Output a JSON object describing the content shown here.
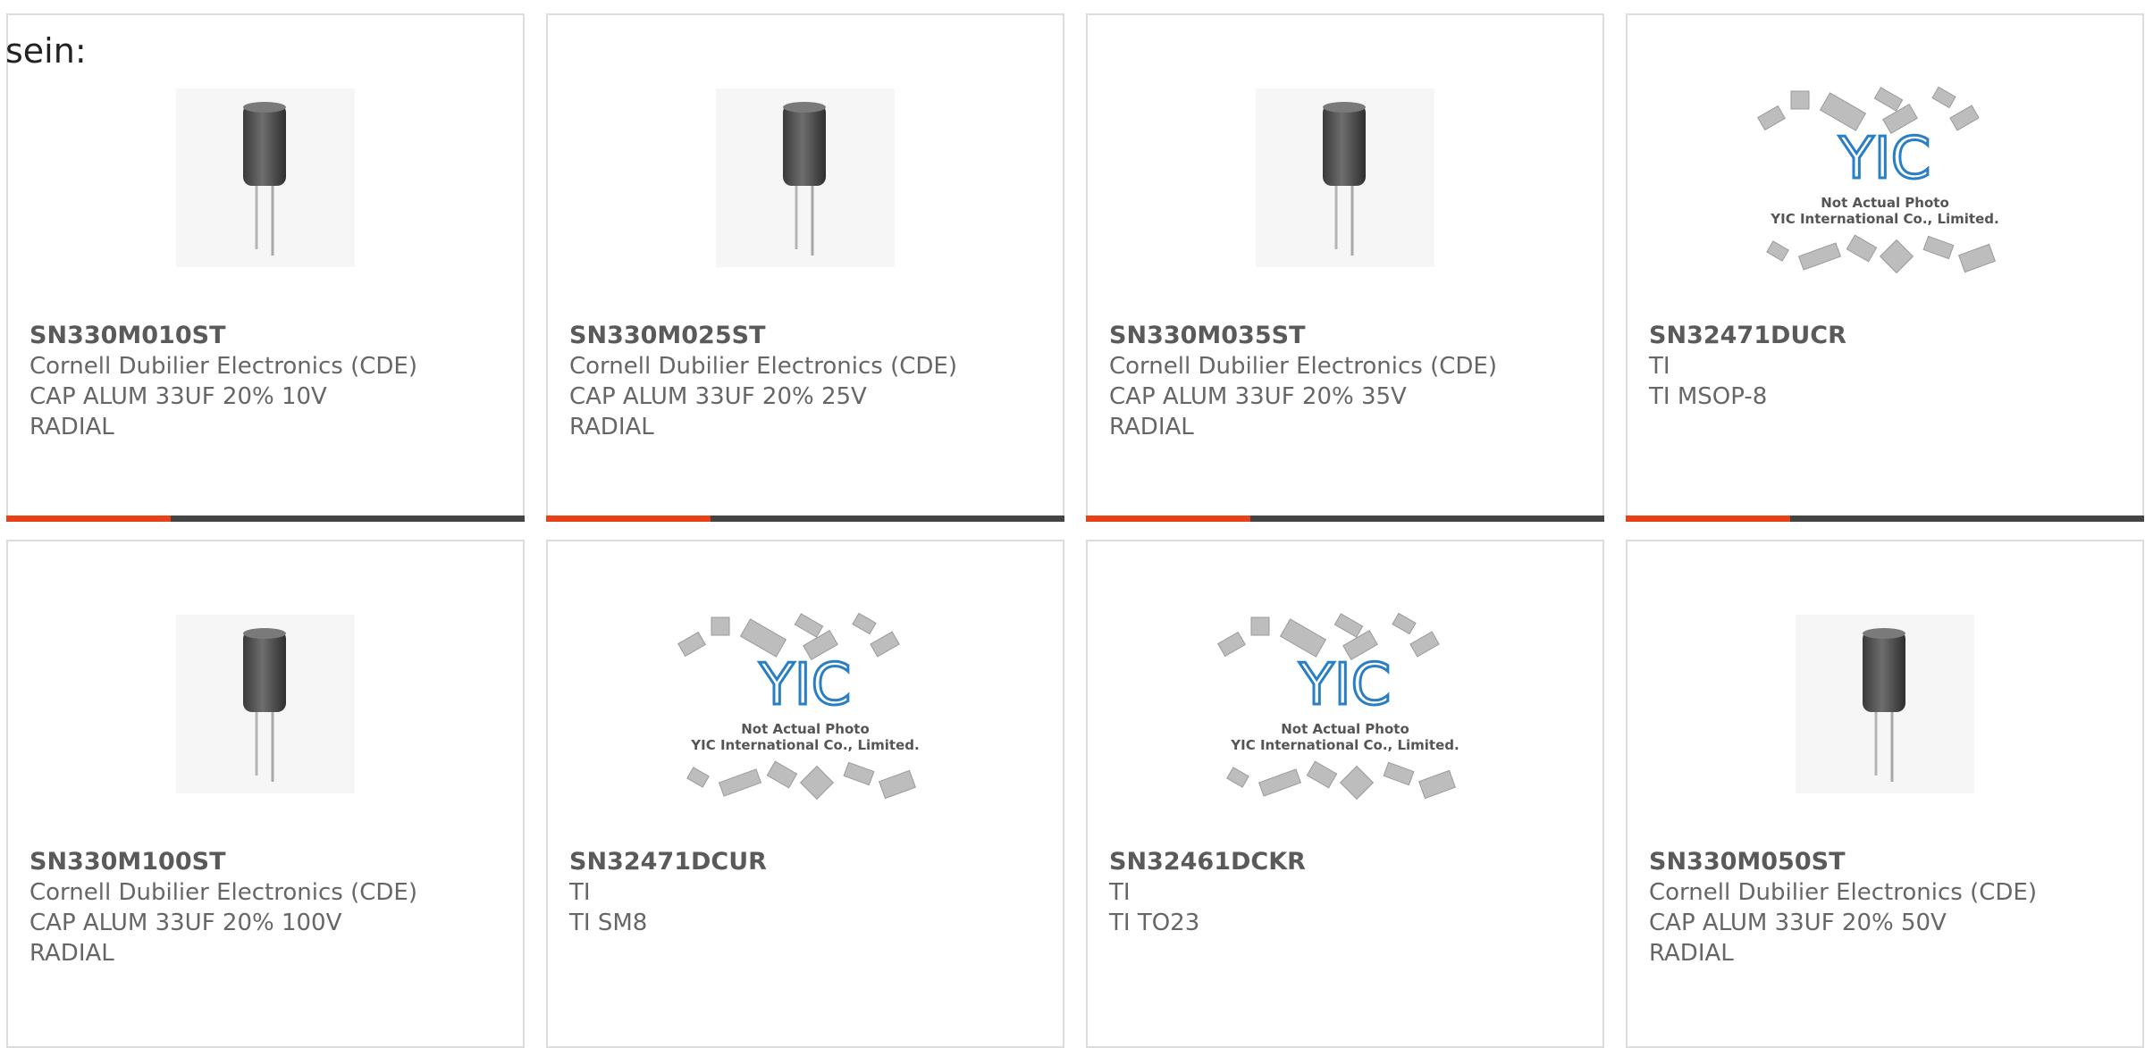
{
  "intro_text": "sein:",
  "colors": {
    "accent": "#e8411a",
    "bar": "#444444",
    "border": "#dcdcdc",
    "text": "#666666"
  },
  "placeholder_image": {
    "line1": "Not Actual Photo",
    "line2": "YIC International Co., Limited.",
    "logo": "YIC"
  },
  "products": [
    {
      "part": "SN330M010ST",
      "manufacturer": "Cornell Dubilier Electronics (CDE)",
      "desc": "CAP ALUM 33UF 20% 10V",
      "desc2": "RADIAL",
      "image": "capacitor"
    },
    {
      "part": "SN330M025ST",
      "manufacturer": "Cornell Dubilier Electronics (CDE)",
      "desc": "CAP ALUM 33UF 20% 25V",
      "desc2": "RADIAL",
      "image": "capacitor"
    },
    {
      "part": "SN330M035ST",
      "manufacturer": "Cornell Dubilier Electronics (CDE)",
      "desc": "CAP ALUM 33UF 20% 35V",
      "desc2": "RADIAL",
      "image": "capacitor"
    },
    {
      "part": "SN32471DUCR",
      "manufacturer": "TI",
      "desc": "TI MSOP-8",
      "desc2": "",
      "image": "placeholder"
    },
    {
      "part": "SN330M100ST",
      "manufacturer": "Cornell Dubilier Electronics (CDE)",
      "desc": "CAP ALUM 33UF 20% 100V",
      "desc2": "RADIAL",
      "image": "capacitor"
    },
    {
      "part": "SN32471DCUR",
      "manufacturer": "TI",
      "desc": "TI SM8",
      "desc2": "",
      "image": "placeholder"
    },
    {
      "part": "SN32461DCKR",
      "manufacturer": "TI",
      "desc": "TI TO23",
      "desc2": "",
      "image": "placeholder"
    },
    {
      "part": "SN330M050ST",
      "manufacturer": "Cornell Dubilier Electronics (CDE)",
      "desc": "CAP ALUM 33UF 20% 50V",
      "desc2": "RADIAL",
      "image": "capacitor"
    }
  ]
}
